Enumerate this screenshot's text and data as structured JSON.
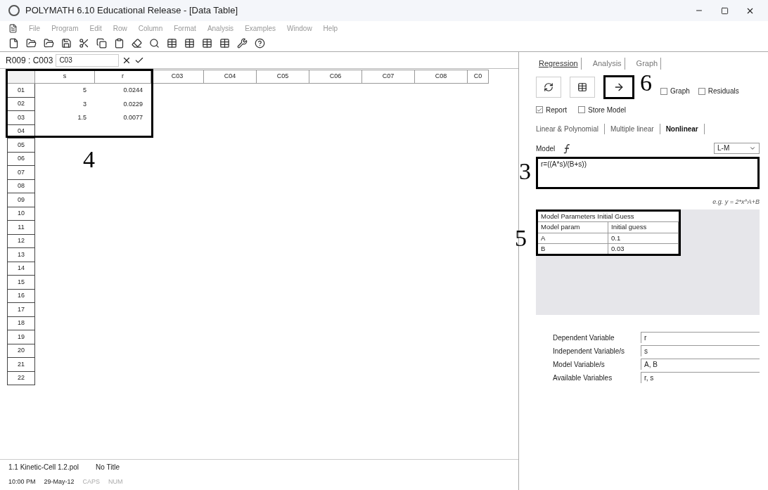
{
  "window": {
    "title": "POLYMATH 6.10 Educational Release - [Data Table]"
  },
  "menu": [
    "File",
    "Program",
    "Edit",
    "Row",
    "Column",
    "Format",
    "Analysis",
    "Examples",
    "Window",
    "Help"
  ],
  "formula_bar": {
    "cell_ref": "R009 : C003",
    "value": "C03"
  },
  "table": {
    "columns": [
      "s",
      "r",
      "C03",
      "C04",
      "C05",
      "C06",
      "C07",
      "C08",
      "C0"
    ],
    "rows": [
      {
        "label": "01",
        "cells": [
          "5",
          "0.0244"
        ]
      },
      {
        "label": "02",
        "cells": [
          "3",
          "0.0229"
        ]
      },
      {
        "label": "03",
        "cells": [
          "1.5",
          "0.0077"
        ]
      },
      {
        "label": "04",
        "cells": []
      },
      {
        "label": "05",
        "cells": []
      },
      {
        "label": "06",
        "cells": []
      },
      {
        "label": "07",
        "cells": []
      },
      {
        "label": "08",
        "cells": []
      },
      {
        "label": "09",
        "cells": []
      },
      {
        "label": "10",
        "cells": []
      },
      {
        "label": "11",
        "cells": []
      },
      {
        "label": "12",
        "cells": []
      },
      {
        "label": "13",
        "cells": []
      },
      {
        "label": "14",
        "cells": []
      },
      {
        "label": "15",
        "cells": []
      },
      {
        "label": "16",
        "cells": []
      },
      {
        "label": "17",
        "cells": []
      },
      {
        "label": "18",
        "cells": []
      },
      {
        "label": "19",
        "cells": []
      },
      {
        "label": "20",
        "cells": []
      },
      {
        "label": "21",
        "cells": []
      },
      {
        "label": "22",
        "cells": []
      }
    ]
  },
  "status_bar": {
    "file": "1.1 Kinetic-Cell 1.2.pol",
    "title": "No Title",
    "time": "10:00 PM",
    "date": "29-May-12",
    "caps": "CAPS",
    "num": "NUM"
  },
  "panel": {
    "tabs": [
      {
        "label": "Regression",
        "selected": true
      },
      {
        "label": "Analysis",
        "selected": false
      },
      {
        "label": "Graph",
        "selected": false
      }
    ],
    "options": [
      {
        "label": "Graph",
        "checked": false
      },
      {
        "label": "Residuals",
        "checked": false
      },
      {
        "label": "Report",
        "checked": true
      },
      {
        "label": "Store Model",
        "checked": false
      }
    ],
    "subtabs": [
      {
        "label": "Linear & Polynomial",
        "selected": false
      },
      {
        "label": "Multiple linear",
        "selected": false
      },
      {
        "label": "Nonlinear",
        "selected": true
      }
    ],
    "model_label": "Model",
    "method": "L-M",
    "model": "r=((A*s)/(B+s))",
    "example": "e.g. y = 2*x^A+B",
    "params": {
      "title": "Model Parameters Initial Guess",
      "columns": [
        "Model param",
        "Initial guess"
      ],
      "rows": [
        [
          "A",
          "0.1"
        ],
        [
          "B",
          "0.03"
        ]
      ]
    },
    "variables": [
      {
        "label": "Dependent Variable",
        "value": "r"
      },
      {
        "label": "Independent Variable/s",
        "value": "s"
      },
      {
        "label": "Model Variable/s",
        "value": "A, B"
      },
      {
        "label": "Available Variables",
        "value": "r, s"
      }
    ]
  },
  "annotations": [
    "4",
    "3",
    "5",
    "6"
  ]
}
